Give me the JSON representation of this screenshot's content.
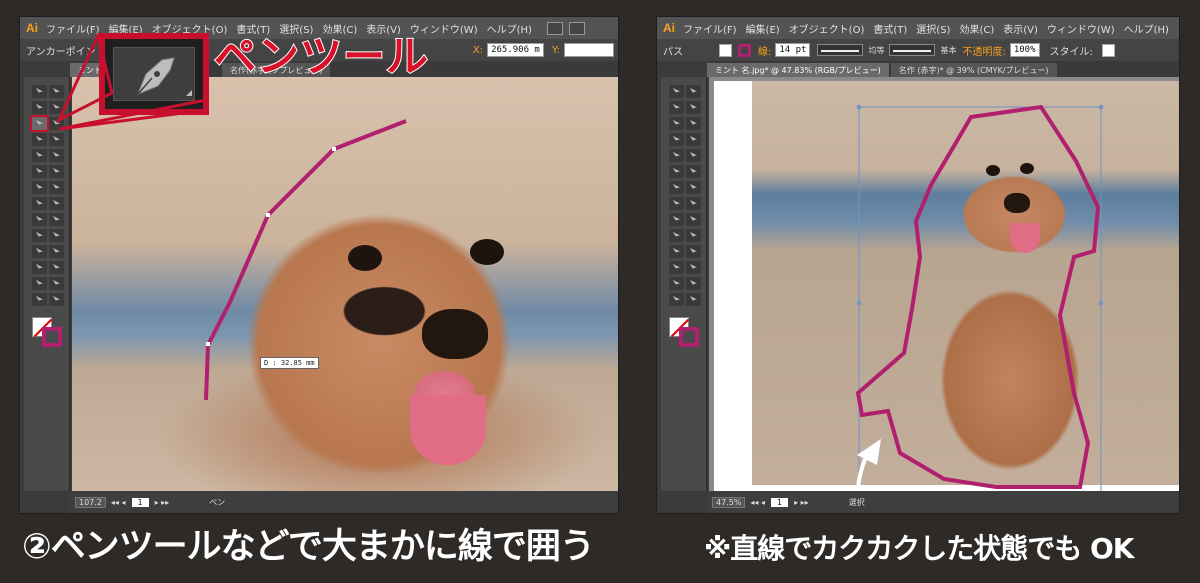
{
  "left_screenshot": {
    "app_icon": "Ai",
    "menus": [
      "ファイル(F)",
      "編集(E)",
      "オブジェクト(O)",
      "書式(T)",
      "選択(S)",
      "効果(C)",
      "表示(V)",
      "ウィンドウ(W)",
      "ヘルプ(H)"
    ],
    "control": {
      "label": "アンカーポイント",
      "x_label": "X:",
      "x_value": "265.906 m",
      "y_label": "Y:"
    },
    "tab_label": "ミント",
    "tab_label_2": "名作(赤字)(ププレビュー)",
    "distance_readout": "D : 32.85 mm",
    "status": {
      "zoom": "107.2",
      "page": "1",
      "tool_name": "ペン"
    }
  },
  "right_screenshot": {
    "app_icon": "Ai",
    "menus": [
      "ファイル(F)",
      "編集(E)",
      "オブジェクト(O)",
      "書式(T)",
      "選択(S)",
      "効果(C)",
      "表示(V)",
      "ウィンドウ(W)",
      "ヘルプ(H)"
    ],
    "control": {
      "label": "パス",
      "stroke_label": "線:",
      "stroke_weight": "14 pt",
      "uniform": "均等",
      "basic": "基本",
      "opacity_label": "不透明度:",
      "opacity_value": "100%",
      "style_label": "スタイル:"
    },
    "tab_label": "ミント 名.jpg* @ 47.83% (RGB/プレビュー)",
    "tab_label_2": "名作 (赤字)* @ 39% (CMYK/プレビュー)",
    "status": {
      "zoom": "47.5%",
      "page": "1",
      "tool_name": "選択"
    }
  },
  "callout": {
    "title": "ペンツール",
    "icon": "pen-tool-icon"
  },
  "captions": {
    "left": "②ペンツールなどで大まかに線で囲う",
    "right": "※直線でカクカクした状態でも OK"
  },
  "colors": {
    "accent_red": "#d8102a",
    "stroke_magenta": "#b0206e",
    "ai_orange": "#f7a21b",
    "background": "#2e2a27"
  }
}
